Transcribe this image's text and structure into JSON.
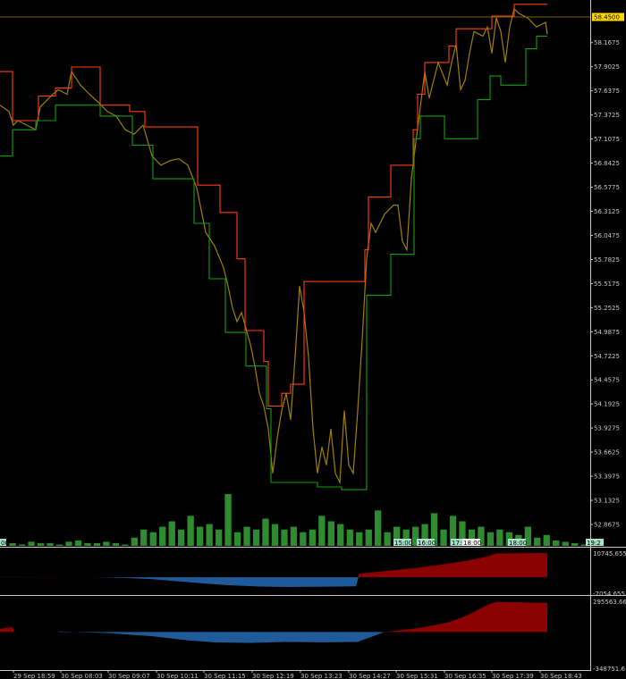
{
  "chart_data": {
    "type": "line",
    "title": "",
    "x_unit": "bar",
    "main": {
      "ylim": [
        52.6,
        58.64
      ],
      "current_price": "58.4500",
      "y_ticks": [
        "58.1675",
        "57.9025",
        "57.6375",
        "57.3725",
        "57.1075",
        "56.8425",
        "56.5775",
        "56.3125",
        "56.0475",
        "55.7825",
        "55.5175",
        "55.2525",
        "54.9875",
        "54.7225",
        "54.4575",
        "54.1925",
        "53.9275",
        "53.6625",
        "53.3975",
        "53.1325",
        "52.8675"
      ],
      "y_tick_values": [
        58.1675,
        57.9025,
        57.6375,
        57.3725,
        57.1075,
        56.8425,
        56.5775,
        56.3125,
        56.0475,
        55.7825,
        55.5175,
        55.2525,
        54.9875,
        54.7225,
        54.4575,
        54.1925,
        53.9275,
        53.6625,
        53.3975,
        53.1325,
        52.8675
      ],
      "series": [
        {
          "name": "price",
          "color": "#a08000",
          "points": [
            [
              0,
              57.48
            ],
            [
              10,
              57.41
            ],
            [
              15,
              57.26
            ],
            [
              20,
              57.31
            ],
            [
              30,
              57.26
            ],
            [
              40,
              57.21
            ],
            [
              45,
              57.46
            ],
            [
              55,
              57.56
            ],
            [
              65,
              57.65
            ],
            [
              75,
              57.6
            ],
            [
              80,
              57.85
            ],
            [
              90,
              57.7
            ],
            [
              100,
              57.6
            ],
            [
              110,
              57.51
            ],
            [
              120,
              57.41
            ],
            [
              130,
              57.36
            ],
            [
              140,
              57.21
            ],
            [
              150,
              57.16
            ],
            [
              160,
              57.26
            ],
            [
              170,
              56.92
            ],
            [
              180,
              56.82
            ],
            [
              190,
              56.87
            ],
            [
              200,
              56.89
            ],
            [
              210,
              56.82
            ],
            [
              220,
              56.57
            ],
            [
              230,
              56.08
            ],
            [
              240,
              55.93
            ],
            [
              250,
              55.69
            ],
            [
              255,
              55.49
            ],
            [
              260,
              55.25
            ],
            [
              265,
              55.1
            ],
            [
              270,
              55.2
            ],
            [
              280,
              54.85
            ],
            [
              285,
              54.61
            ],
            [
              290,
              54.31
            ],
            [
              295,
              54.17
            ],
            [
              300,
              53.92
            ],
            [
              305,
              53.43
            ],
            [
              310,
              53.82
            ],
            [
              315,
              54.12
            ],
            [
              320,
              54.31
            ],
            [
              325,
              54.02
            ],
            [
              330,
              54.71
            ],
            [
              335,
              55.49
            ],
            [
              340,
              55.2
            ],
            [
              345,
              54.71
            ],
            [
              350,
              53.92
            ],
            [
              355,
              53.43
            ],
            [
              360,
              53.72
            ],
            [
              365,
              53.52
            ],
            [
              370,
              53.92
            ],
            [
              375,
              53.43
            ],
            [
              380,
              53.33
            ],
            [
              385,
              54.12
            ],
            [
              390,
              53.52
            ],
            [
              395,
              53.43
            ],
            [
              400,
              54.12
            ],
            [
              405,
              54.9
            ],
            [
              410,
              55.79
            ],
            [
              415,
              56.18
            ],
            [
              420,
              56.08
            ],
            [
              430,
              56.28
            ],
            [
              440,
              56.38
            ],
            [
              445,
              56.38
            ],
            [
              450,
              55.98
            ],
            [
              455,
              55.89
            ],
            [
              460,
              56.67
            ],
            [
              465,
              57.07
            ],
            [
              470,
              57.46
            ],
            [
              475,
              57.85
            ],
            [
              480,
              57.56
            ],
            [
              490,
              57.95
            ],
            [
              500,
              57.7
            ],
            [
              505,
              57.95
            ],
            [
              510,
              58.15
            ],
            [
              515,
              57.65
            ],
            [
              520,
              57.75
            ],
            [
              525,
              58.05
            ],
            [
              530,
              58.29
            ],
            [
              540,
              58.24
            ],
            [
              545,
              58.34
            ],
            [
              550,
              58.05
            ],
            [
              555,
              58.44
            ],
            [
              560,
              58.29
            ],
            [
              565,
              57.95
            ],
            [
              570,
              58.34
            ],
            [
              575,
              58.54
            ],
            [
              580,
              58.49
            ],
            [
              590,
              58.44
            ],
            [
              600,
              58.34
            ],
            [
              610,
              58.39
            ],
            [
              612,
              58.26
            ]
          ]
        },
        {
          "name": "upper-channel",
          "color": "#ff4010",
          "points": [
            [
              0,
              57.85
            ],
            [
              14,
              57.85
            ],
            [
              14,
              57.31
            ],
            [
              43,
              57.31
            ],
            [
              43,
              57.58
            ],
            [
              62,
              57.58
            ],
            [
              62,
              57.67
            ],
            [
              80,
              57.67
            ],
            [
              80,
              57.9
            ],
            [
              112,
              57.9
            ],
            [
              112,
              57.48
            ],
            [
              145,
              57.48
            ],
            [
              145,
              57.41
            ],
            [
              162,
              57.41
            ],
            [
              162,
              57.24
            ],
            [
              221,
              57.24
            ],
            [
              221,
              56.6
            ],
            [
              246,
              56.6
            ],
            [
              246,
              56.3
            ],
            [
              265,
              56.3
            ],
            [
              265,
              55.79
            ],
            [
              274,
              55.79
            ],
            [
              274,
              55.0
            ],
            [
              295,
              55.0
            ],
            [
              295,
              54.66
            ],
            [
              300,
              54.66
            ],
            [
              300,
              54.17
            ],
            [
              315,
              54.17
            ],
            [
              315,
              54.31
            ],
            [
              325,
              54.31
            ],
            [
              325,
              54.41
            ],
            [
              340,
              54.41
            ],
            [
              340,
              55.54
            ],
            [
              408,
              55.54
            ],
            [
              408,
              55.89
            ],
            [
              412,
              55.89
            ],
            [
              412,
              56.47
            ],
            [
              437,
              56.47
            ],
            [
              437,
              56.82
            ],
            [
              462,
              56.82
            ],
            [
              462,
              57.21
            ],
            [
              467,
              57.21
            ],
            [
              467,
              57.6
            ],
            [
              475,
              57.6
            ],
            [
              475,
              57.95
            ],
            [
              502,
              57.95
            ],
            [
              502,
              58.13
            ],
            [
              510,
              58.13
            ],
            [
              510,
              58.32
            ],
            [
              550,
              58.32
            ],
            [
              550,
              58.46
            ],
            [
              575,
              58.46
            ],
            [
              575,
              58.59
            ],
            [
              612,
              58.59
            ]
          ]
        },
        {
          "name": "lower-channel",
          "color": "#10a010",
          "points": [
            [
              0,
              56.92
            ],
            [
              14,
              56.92
            ],
            [
              14,
              57.21
            ],
            [
              40,
              57.21
            ],
            [
              40,
              57.31
            ],
            [
              62,
              57.31
            ],
            [
              62,
              57.48
            ],
            [
              112,
              57.48
            ],
            [
              112,
              57.36
            ],
            [
              148,
              57.36
            ],
            [
              148,
              57.04
            ],
            [
              171,
              57.04
            ],
            [
              171,
              56.67
            ],
            [
              217,
              56.67
            ],
            [
              217,
              56.18
            ],
            [
              234,
              56.18
            ],
            [
              234,
              55.57
            ],
            [
              252,
              55.57
            ],
            [
              252,
              54.98
            ],
            [
              275,
              54.98
            ],
            [
              275,
              54.61
            ],
            [
              298,
              54.61
            ],
            [
              298,
              54.14
            ],
            [
              303,
              54.14
            ],
            [
              303,
              53.33
            ],
            [
              355,
              53.33
            ],
            [
              355,
              53.28
            ],
            [
              382,
              53.28
            ],
            [
              382,
              53.25
            ],
            [
              410,
              53.25
            ],
            [
              410,
              55.39
            ],
            [
              437,
              55.39
            ],
            [
              437,
              55.84
            ],
            [
              463,
              55.84
            ],
            [
              463,
              57.11
            ],
            [
              470,
              57.11
            ],
            [
              470,
              57.36
            ],
            [
              497,
              57.36
            ],
            [
              497,
              57.11
            ],
            [
              534,
              57.11
            ],
            [
              534,
              57.54
            ],
            [
              548,
              57.54
            ],
            [
              548,
              57.8
            ],
            [
              560,
              57.8
            ],
            [
              560,
              57.7
            ],
            [
              588,
              57.7
            ],
            [
              588,
              58.1
            ],
            [
              600,
              58.1
            ],
            [
              600,
              58.24
            ],
            [
              612,
              58.24
            ]
          ]
        }
      ]
    },
    "volume": {
      "color": "#2e8b2e",
      "values": [
        4,
        2,
        1,
        3,
        2,
        2,
        1,
        3,
        4,
        2,
        2,
        3,
        2,
        1,
        6,
        12,
        10,
        14,
        18,
        12,
        22,
        14,
        16,
        12,
        38,
        10,
        14,
        12,
        20,
        16,
        12,
        14,
        10,
        12,
        22,
        18,
        16,
        12,
        10,
        12,
        26,
        10,
        14,
        12,
        14,
        16,
        24,
        12,
        22,
        18,
        12,
        14,
        10,
        12,
        10,
        8,
        14,
        6,
        8,
        4,
        3,
        2,
        1
      ],
      "markers": [
        "00",
        "15:00",
        "16:00",
        "17:00",
        "18:00",
        "18:00",
        "19:2"
      ]
    },
    "indicator1": {
      "ylim": [
        -7054.655,
        10745.655
      ],
      "labels": [
        "10745.655",
        "-7054.655"
      ],
      "positive_color": "#8b0000",
      "negative_color": "#1f5a9a",
      "points": [
        [
          0,
          100
        ],
        [
          60,
          80
        ],
        [
          110,
          -50
        ],
        [
          140,
          -300
        ],
        [
          170,
          -800
        ],
        [
          200,
          -1800
        ],
        [
          230,
          -2800
        ],
        [
          260,
          -3600
        ],
        [
          290,
          -4100
        ],
        [
          320,
          -4300
        ],
        [
          350,
          -4200
        ],
        [
          380,
          -4100
        ],
        [
          398,
          -4000
        ],
        [
          402,
          1600
        ],
        [
          430,
          2700
        ],
        [
          460,
          3900
        ],
        [
          490,
          5400
        ],
        [
          520,
          7200
        ],
        [
          545,
          9200
        ],
        [
          555,
          10600
        ],
        [
          612,
          10745
        ]
      ]
    },
    "indicator2": {
      "ylim": [
        -348751.6,
        295563.66
      ],
      "labels": [
        "295563.66",
        "-348751.6"
      ],
      "positive_color": "#8b0000",
      "negative_color": "#1f5a9a",
      "points": [
        [
          0,
          30000
        ],
        [
          14,
          50000
        ],
        [
          16,
          0
        ],
        [
          64,
          0
        ],
        [
          66,
          5000
        ],
        [
          120,
          -10000
        ],
        [
          170,
          -40000
        ],
        [
          210,
          -80000
        ],
        [
          240,
          -100000
        ],
        [
          280,
          -105000
        ],
        [
          320,
          -95000
        ],
        [
          360,
          -100000
        ],
        [
          400,
          -95000
        ],
        [
          430,
          0
        ],
        [
          470,
          40000
        ],
        [
          500,
          90000
        ],
        [
          520,
          150000
        ],
        [
          545,
          260000
        ],
        [
          555,
          290000
        ],
        [
          612,
          280000
        ]
      ]
    },
    "x_ticks": [
      "29 Sep 18:59",
      "30 Sep 08:03",
      "30 Sep 09:07",
      "30 Sep 10:11",
      "30 Sep 11:15",
      "30 Sep 12:19",
      "30 Sep 13:23",
      "30 Sep 14:27",
      "30 Sep 15:31",
      "30 Sep 16:35",
      "30 Sep 17:39",
      "30 Sep 18:43"
    ],
    "x_tick_bars": [
      15,
      68,
      121,
      175,
      228,
      282,
      336,
      390,
      443,
      497,
      550,
      604
    ],
    "colors": {
      "background": "#000000",
      "grid_line": "#c8c8c8",
      "price_line": "#a08000",
      "current_price_box": "#ffd700"
    }
  }
}
